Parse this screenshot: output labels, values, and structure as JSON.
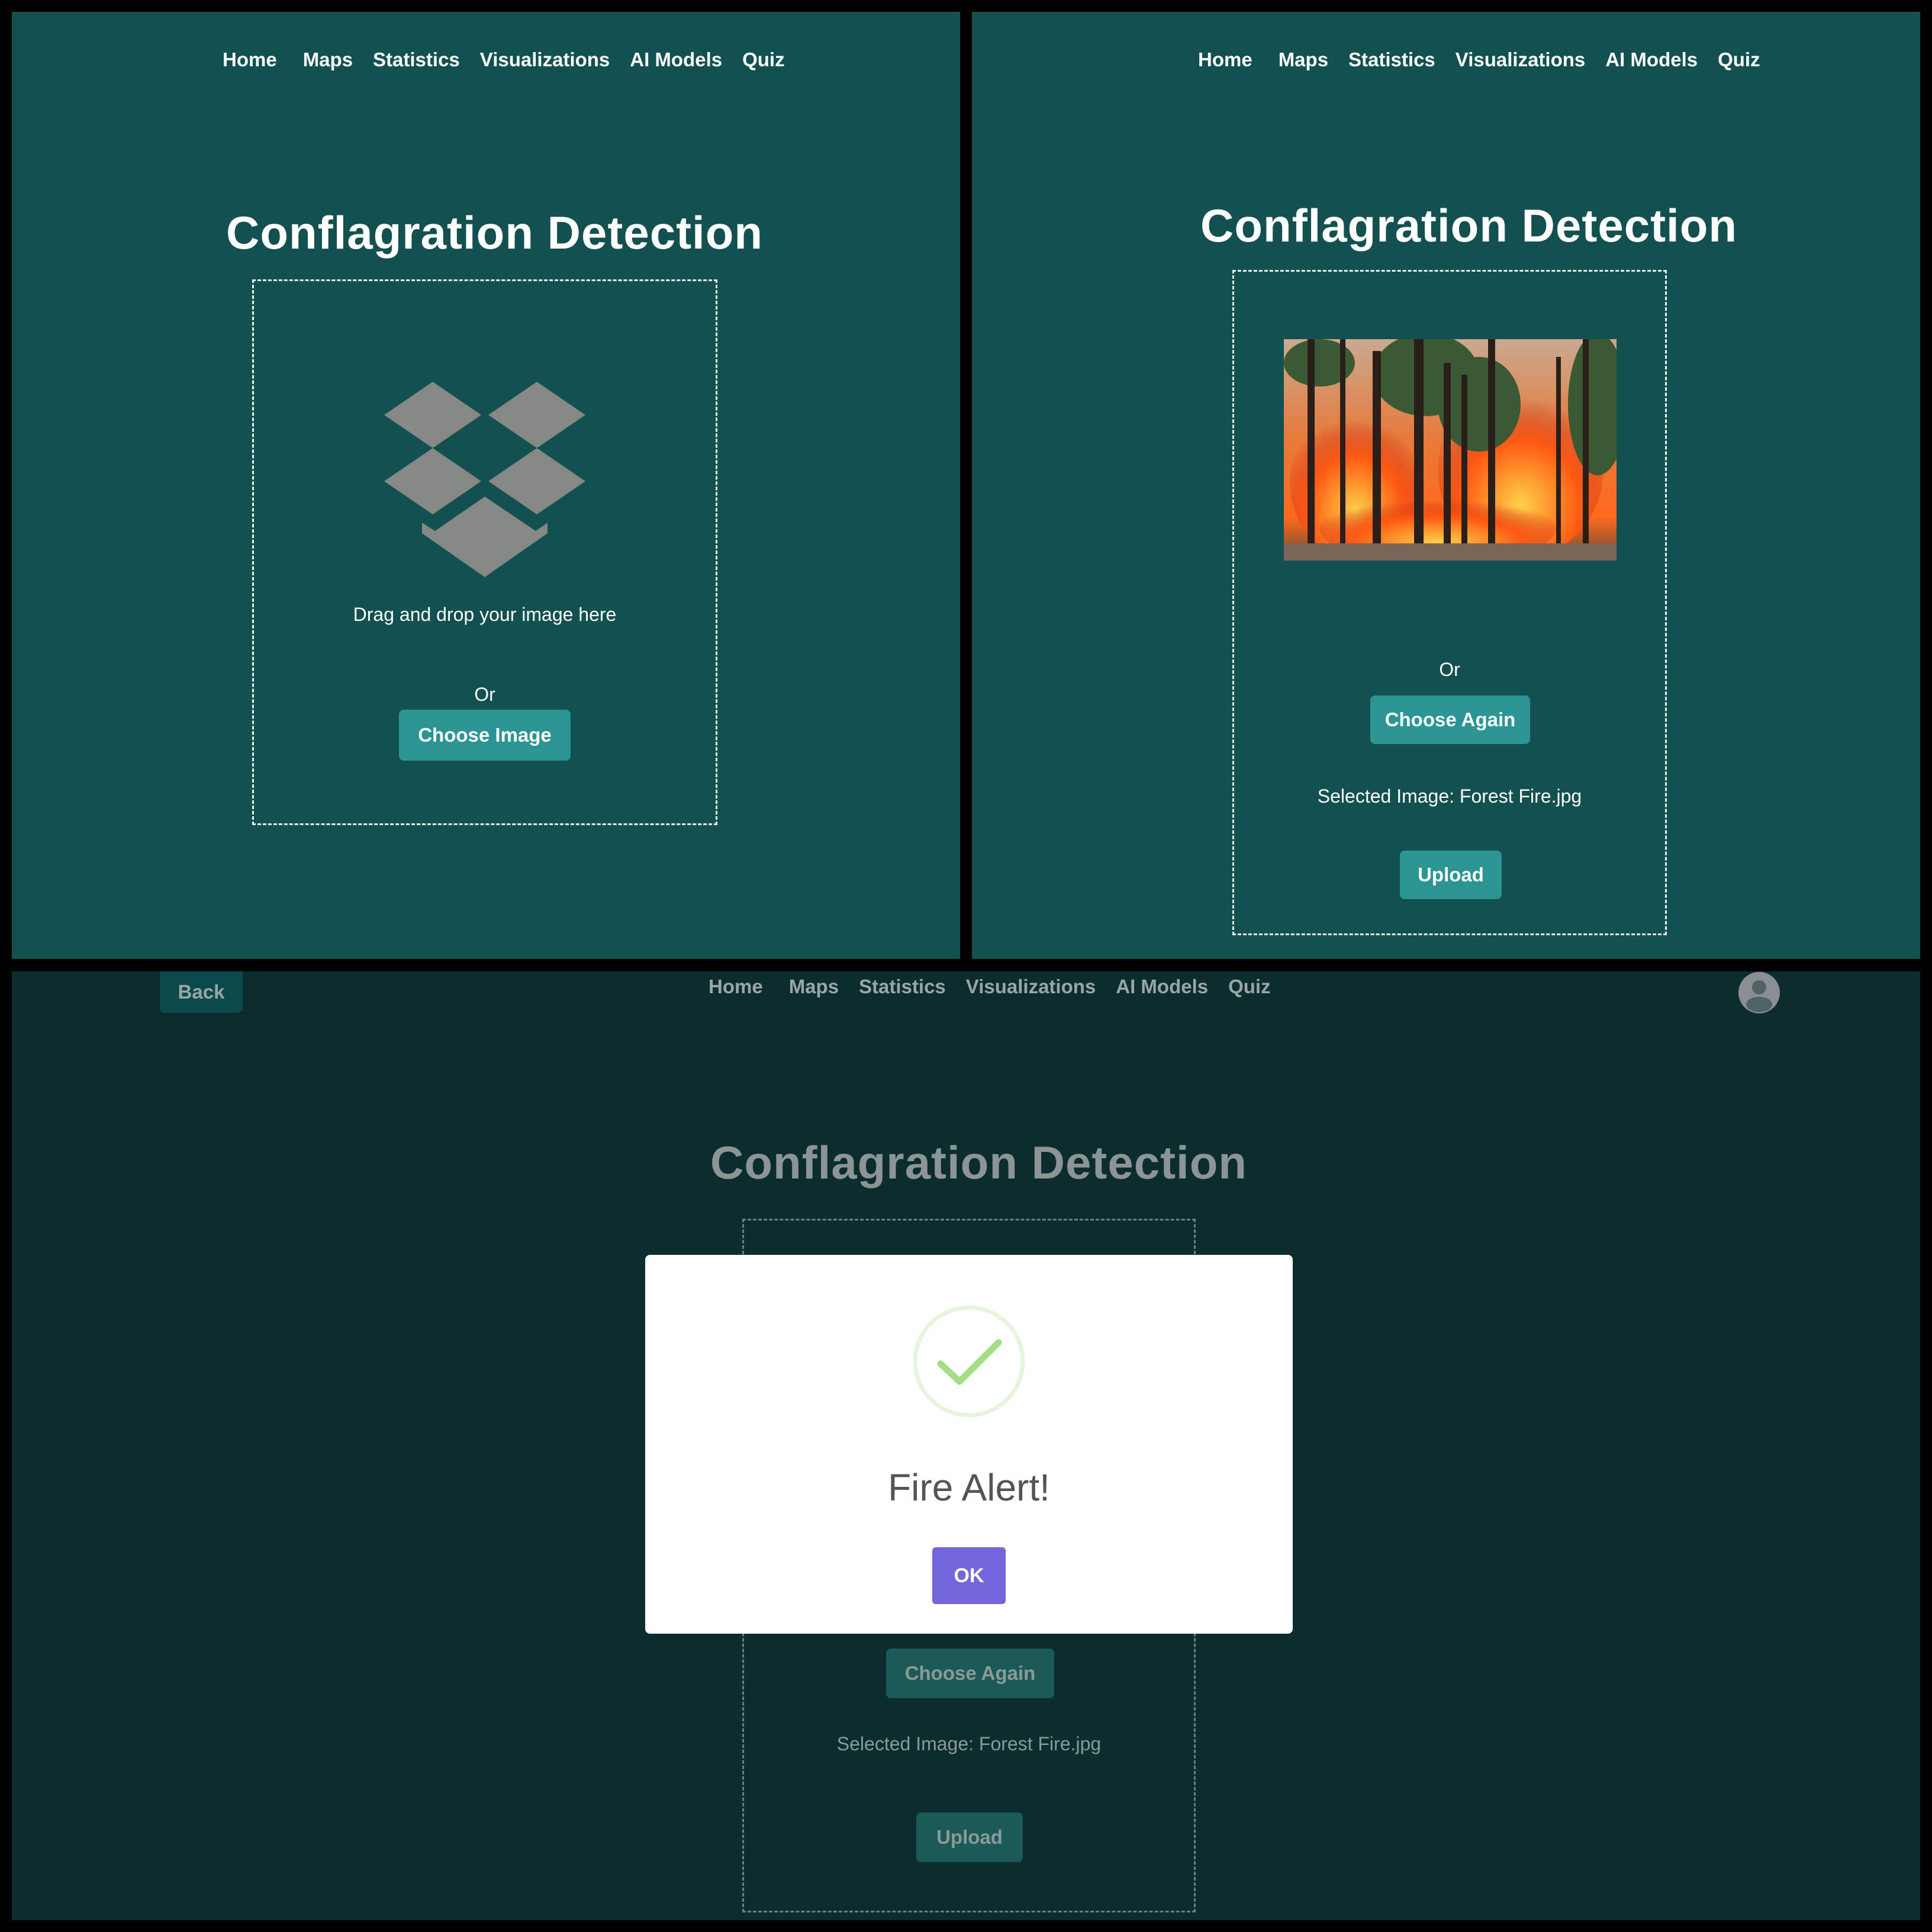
{
  "nav": {
    "home": "Home",
    "maps": "Maps",
    "statistics": "Statistics",
    "visualizations": "Visualizations",
    "ai_models": "AI Models",
    "quiz": "Quiz"
  },
  "page_title": "Conflagration Detection",
  "screen1": {
    "drag_text": "Drag and drop your image here",
    "or_text": "Or",
    "choose_button": "Choose Image"
  },
  "screen2": {
    "or_text": "Or",
    "choose_again_button": "Choose Again",
    "selected_image_text": "Selected Image: Forest Fire.jpg",
    "upload_button": "Upload"
  },
  "screen3": {
    "back_button": "Back",
    "choose_again_button": "Choose Again",
    "selected_image_text": "Selected Image: Forest Fire.jpg",
    "upload_button": "Upload",
    "modal": {
      "title": "Fire Alert!",
      "ok_button": "OK"
    }
  },
  "colors": {
    "panel_bg": "#135050",
    "overlay_bg": "#0b2d2d",
    "button": "#2a9592",
    "ok_button": "#7366dd",
    "success_check": "#a5dc86"
  },
  "icons": [
    "dropbox-icon",
    "forest-fire-image",
    "user-avatar-icon",
    "success-check-icon"
  ]
}
